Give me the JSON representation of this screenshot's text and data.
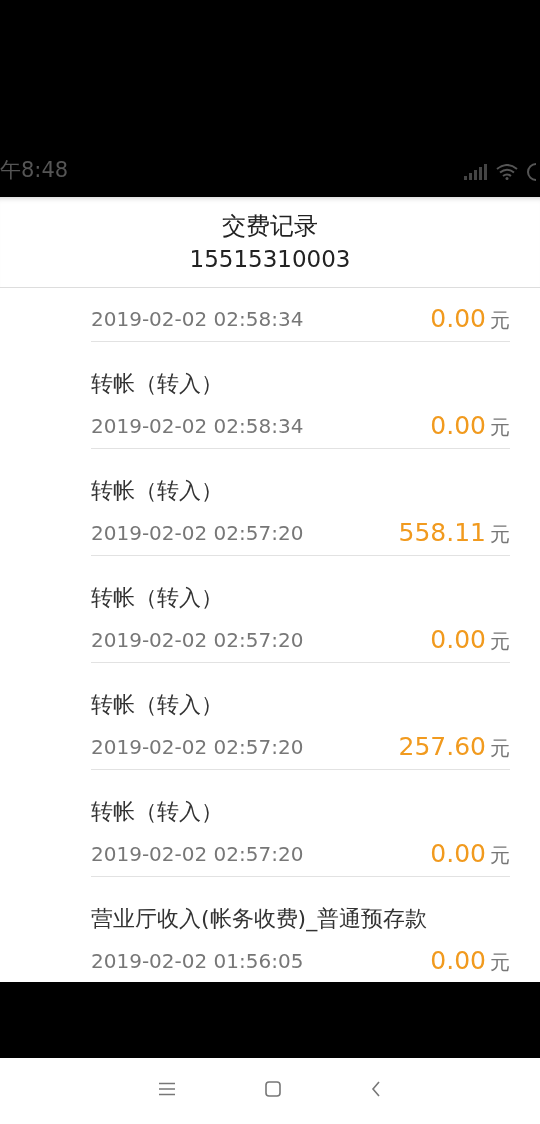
{
  "status_bar": {
    "time": "午8:48"
  },
  "header": {
    "title": "交费记录",
    "subtitle": "15515310003"
  },
  "records": [
    {
      "date": "2019-02-02 02:58:34",
      "amount": "0.00",
      "unit": "元"
    },
    {
      "title": "转帐（转入）",
      "date": "2019-02-02 02:58:34",
      "amount": "0.00",
      "unit": "元"
    },
    {
      "title": "转帐（转入）",
      "date": "2019-02-02 02:57:20",
      "amount": "558.11",
      "unit": "元"
    },
    {
      "title": "转帐（转入）",
      "date": "2019-02-02 02:57:20",
      "amount": "0.00",
      "unit": "元"
    },
    {
      "title": "转帐（转入）",
      "date": "2019-02-02 02:57:20",
      "amount": "257.60",
      "unit": "元"
    },
    {
      "title": "转帐（转入）",
      "date": "2019-02-02 02:57:20",
      "amount": "0.00",
      "unit": "元"
    },
    {
      "title": "营业厅收入(帐务收费)_普通预存款",
      "date": "2019-02-02 01:56:05",
      "amount": "0.00",
      "unit": "元"
    }
  ]
}
